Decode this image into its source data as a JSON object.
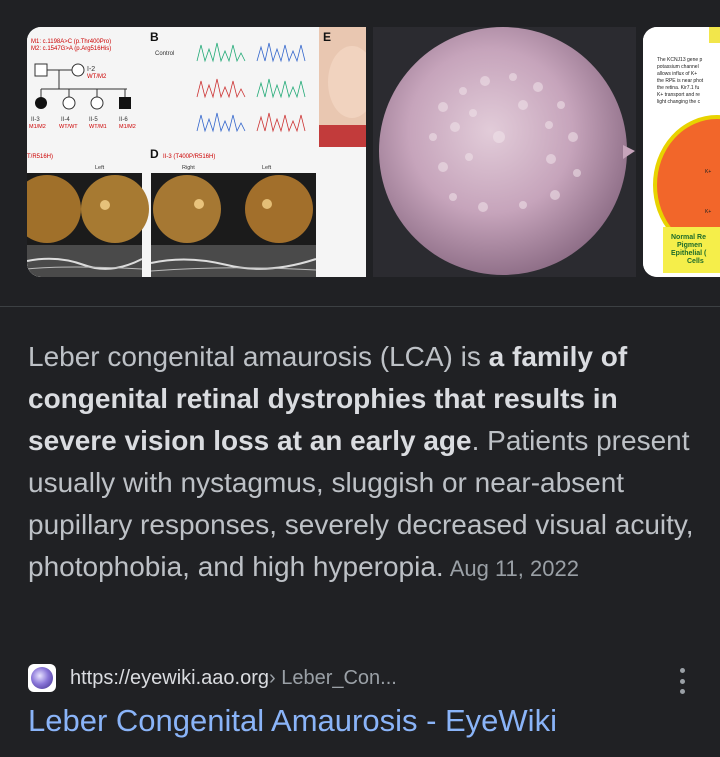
{
  "images": {
    "img1_text": {
      "panel_b": "B",
      "panel_e": "E",
      "panel_d": "D",
      "mut1": "M1: c.1198A>C (p.Thr400Pro)",
      "mut2": "M2: c.1547G>A (p.Arg516His)",
      "control": "Control",
      "ped_i2": "I-2",
      "ped_ii3": "II-3",
      "ped_ii4": "II-4",
      "ped_ii5": "II-5",
      "ped_ii6": "II-6",
      "ped_wt_m2": "WT/M2",
      "ped_m1_m2": "M1/M2",
      "ped_wt_wt": "WT/WT",
      "ped_wt_m1": "WT/M1",
      "left": "Left",
      "right": "Right",
      "d_label": "II-3 (T400P/R516H)",
      "left_label": "T/R516H)"
    },
    "img3_text": {
      "line1": "The KCNJ13 gene p",
      "line2": "potassium channel",
      "line3": "allows influx of K+",
      "line4": "the RPE is near phot",
      "line5": "the retina. Kir7.1 fu",
      "line6": "K+ transport and re",
      "line7": "light changing the c",
      "k1": "K+",
      "k2": "K+",
      "caption": "Normal Re Pigmen Epithelial ( Cells"
    }
  },
  "snippet": {
    "part1": "Leber congenital amaurosis (LCA) is ",
    "bold": "a family of congenital retinal dystrophies that results in severe vision loss at an early age",
    "part2": ". Patients present usually with nystagmus, sluggish or near-absent pupillary responses, severely decreased visual acuity, photophobia, and high hyperopia.",
    "date": "Aug 11, 2022"
  },
  "source": {
    "url": "https://eyewiki.aao.org",
    "breadcrumb": " › Leber_Con...",
    "title": "Leber Congenital Amaurosis - EyeWiki"
  },
  "icons": {
    "favicon": "eyewiki-favicon-icon",
    "more": "more-vert-icon"
  }
}
